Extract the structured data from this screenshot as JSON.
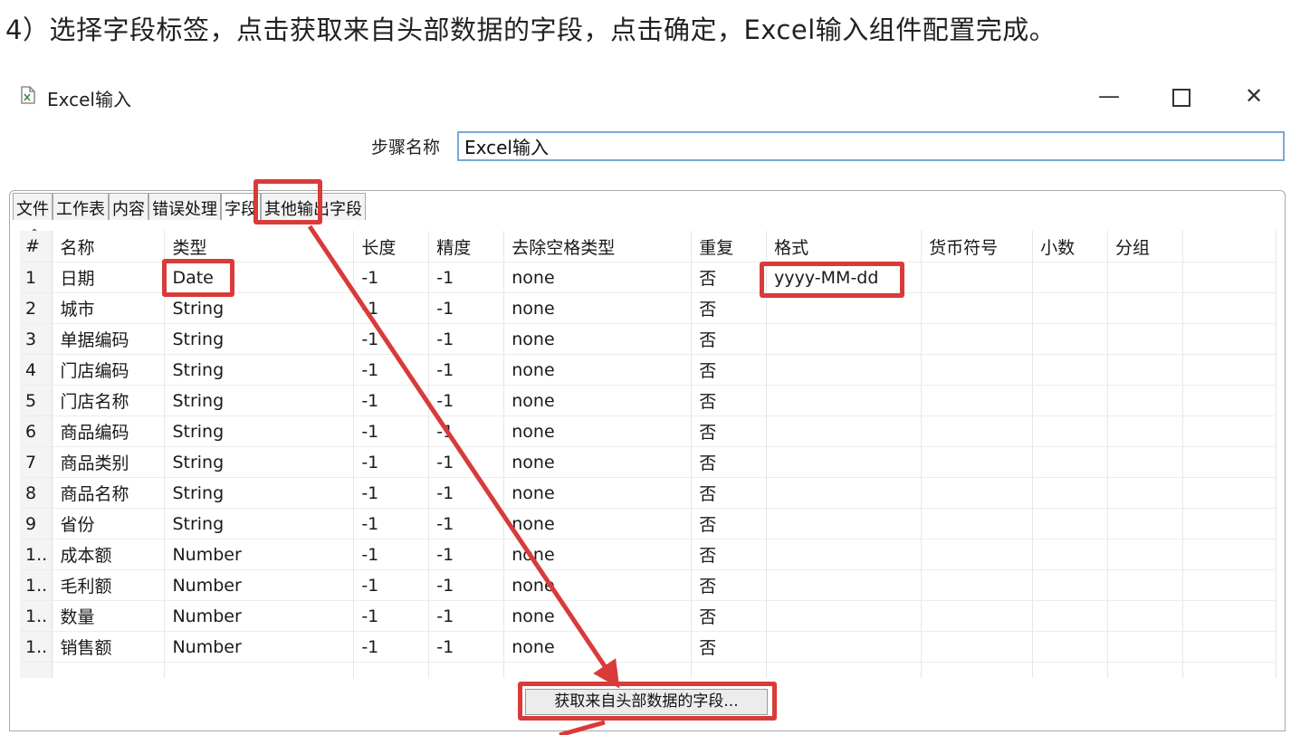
{
  "caption": "4）选择字段标签，点击获取来自头部数据的字段，点击确定，Excel输入组件配置完成。",
  "window": {
    "title": "Excel输入",
    "minimize_glyph": "—",
    "close_glyph": "✕",
    "icons": {
      "app": "excel-file-icon",
      "minimize": "minimize-icon",
      "maximize": "maximize-icon",
      "close": "close-icon"
    }
  },
  "step": {
    "label": "步骤名称",
    "value": "Excel输入"
  },
  "tabs": [
    {
      "label": "文件"
    },
    {
      "label": "工作表"
    },
    {
      "label": "内容"
    },
    {
      "label": "错误处理"
    },
    {
      "label": "字段",
      "active": true
    },
    {
      "label": "其他输出字段"
    }
  ],
  "grid": {
    "sort_glyph": "^",
    "columns": [
      "#",
      "名称",
      "类型",
      "长度",
      "精度",
      "去除空格类型",
      "重复",
      "格式",
      "货币符号",
      "小数",
      "分组"
    ],
    "rows": [
      [
        "1",
        "日期",
        "Date",
        "-1",
        "-1",
        "none",
        "否",
        "yyyy-MM-dd",
        "",
        "",
        ""
      ],
      [
        "2",
        "城市",
        "String",
        "-1",
        "-1",
        "none",
        "否",
        "",
        "",
        "",
        ""
      ],
      [
        "3",
        "单据编码",
        "String",
        "-1",
        "-1",
        "none",
        "否",
        "",
        "",
        "",
        ""
      ],
      [
        "4",
        "门店编码",
        "String",
        "-1",
        "-1",
        "none",
        "否",
        "",
        "",
        "",
        ""
      ],
      [
        "5",
        "门店名称",
        "String",
        "-1",
        "-1",
        "none",
        "否",
        "",
        "",
        "",
        ""
      ],
      [
        "6",
        "商品编码",
        "String",
        "-1",
        "-1",
        "none",
        "否",
        "",
        "",
        "",
        ""
      ],
      [
        "7",
        "商品类别",
        "String",
        "-1",
        "-1",
        "none",
        "否",
        "",
        "",
        "",
        ""
      ],
      [
        "8",
        "商品名称",
        "String",
        "-1",
        "-1",
        "none",
        "否",
        "",
        "",
        "",
        ""
      ],
      [
        "9",
        "省份",
        "String",
        "-1",
        "-1",
        "none",
        "否",
        "",
        "",
        "",
        ""
      ],
      [
        "1..",
        "成本额",
        "Number",
        "-1",
        "-1",
        "none",
        "否",
        "",
        "",
        "",
        ""
      ],
      [
        "1..",
        "毛利额",
        "Number",
        "-1",
        "-1",
        "none",
        "否",
        "",
        "",
        "",
        ""
      ],
      [
        "1..",
        "数量",
        "Number",
        "-1",
        "-1",
        "none",
        "否",
        "",
        "",
        "",
        ""
      ],
      [
        "1..",
        "销售额",
        "Number",
        "-1",
        "-1",
        "none",
        "否",
        "",
        "",
        "",
        ""
      ]
    ]
  },
  "get_fields_button": "获取来自头部数据的字段...",
  "annotation_color": "#d93a3a"
}
